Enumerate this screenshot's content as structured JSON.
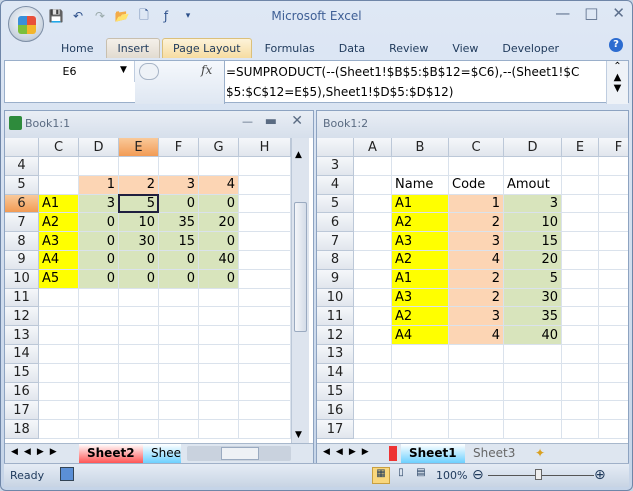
{
  "app": {
    "title": "Microsoft Excel"
  },
  "quick_access": [
    "save-icon",
    "undo-icon",
    "redo-icon",
    "open-icon",
    "new-icon",
    "insert-function-icon",
    "customize-icon"
  ],
  "ribbon_tabs": [
    "Home",
    "Insert",
    "Page Layout",
    "Formulas",
    "Data",
    "Review",
    "View",
    "Developer"
  ],
  "formula_bar": {
    "name_box": "E6",
    "fx": "fx",
    "formula": "=SUMPRODUCT(--(Sheet1!$B$5:$B$12=$C6),--(Sheet1!$C$5:$C$12=E$5),Sheet1!$D$5:$D$12)"
  },
  "colors": {
    "y": "#ffff00",
    "p": "#fcd5b4",
    "g": "#d8e4bc",
    "accent": "#f29b55"
  },
  "left_window": {
    "title": "Book1:1",
    "columns": [
      "C",
      "D",
      "E",
      "F",
      "G",
      "H"
    ],
    "selected_column": "E",
    "selected_row": "6",
    "active_cell": [
      1,
      2
    ],
    "rows": [
      {
        "n": "4",
        "cells": [
          "",
          "",
          "",
          "",
          "",
          ""
        ],
        "fills": [
          "",
          "",
          "",
          "",
          "",
          ""
        ]
      },
      {
        "n": "5",
        "cells": [
          "",
          "1",
          "2",
          "3",
          "4",
          ""
        ],
        "fills": [
          "",
          "p",
          "p",
          "p",
          "p",
          ""
        ]
      },
      {
        "n": "6",
        "cells": [
          "A1",
          "3",
          "5",
          "0",
          "0",
          ""
        ],
        "fills": [
          "y",
          "g",
          "g",
          "g",
          "g",
          ""
        ]
      },
      {
        "n": "7",
        "cells": [
          "A2",
          "0",
          "10",
          "35",
          "20",
          ""
        ],
        "fills": [
          "y",
          "g",
          "g",
          "g",
          "g",
          ""
        ]
      },
      {
        "n": "8",
        "cells": [
          "A3",
          "0",
          "30",
          "15",
          "0",
          ""
        ],
        "fills": [
          "y",
          "g",
          "g",
          "g",
          "g",
          ""
        ]
      },
      {
        "n": "9",
        "cells": [
          "A4",
          "0",
          "0",
          "0",
          "40",
          ""
        ],
        "fills": [
          "y",
          "g",
          "g",
          "g",
          "g",
          ""
        ]
      },
      {
        "n": "10",
        "cells": [
          "A5",
          "0",
          "0",
          "0",
          "0",
          ""
        ],
        "fills": [
          "y",
          "g",
          "g",
          "g",
          "g",
          ""
        ]
      },
      {
        "n": "11",
        "cells": [
          "",
          "",
          "",
          "",
          "",
          ""
        ],
        "fills": [
          "",
          "",
          "",
          "",
          "",
          ""
        ]
      },
      {
        "n": "12",
        "cells": [
          "",
          "",
          "",
          "",
          "",
          ""
        ],
        "fills": [
          "",
          "",
          "",
          "",
          "",
          ""
        ]
      },
      {
        "n": "13",
        "cells": [
          "",
          "",
          "",
          "",
          "",
          ""
        ],
        "fills": [
          "",
          "",
          "",
          "",
          "",
          ""
        ]
      },
      {
        "n": "14",
        "cells": [
          "",
          "",
          "",
          "",
          "",
          ""
        ],
        "fills": [
          "",
          "",
          "",
          "",
          "",
          ""
        ]
      },
      {
        "n": "15",
        "cells": [
          "",
          "",
          "",
          "",
          "",
          ""
        ],
        "fills": [
          "",
          "",
          "",
          "",
          "",
          ""
        ]
      },
      {
        "n": "16",
        "cells": [
          "",
          "",
          "",
          "",
          "",
          ""
        ],
        "fills": [
          "",
          "",
          "",
          "",
          "",
          ""
        ]
      },
      {
        "n": "17",
        "cells": [
          "",
          "",
          "",
          "",
          "",
          ""
        ],
        "fills": [
          "",
          "",
          "",
          "",
          "",
          ""
        ]
      },
      {
        "n": "18",
        "cells": [
          "",
          "",
          "",
          "",
          "",
          ""
        ],
        "fills": [
          "",
          "",
          "",
          "",
          "",
          ""
        ]
      }
    ],
    "sheet_tabs": [
      "Sheet2",
      "Shee"
    ]
  },
  "right_window": {
    "title": "Book1:2",
    "columns": [
      "A",
      "B",
      "C",
      "D",
      "E",
      "F"
    ],
    "rows": [
      {
        "n": "3",
        "cells": [
          "",
          "",
          "",
          "",
          "",
          ""
        ],
        "fills": [
          "",
          "",
          "",
          "",
          "",
          ""
        ]
      },
      {
        "n": "4",
        "cells": [
          "",
          "Name",
          "Code",
          "Amout",
          "",
          ""
        ],
        "fills": [
          "",
          "",
          "",
          "",
          "",
          ""
        ]
      },
      {
        "n": "5",
        "cells": [
          "",
          "A1",
          "1",
          "3",
          "",
          ""
        ],
        "fills": [
          "",
          "y",
          "p",
          "g",
          "",
          ""
        ]
      },
      {
        "n": "6",
        "cells": [
          "",
          "A2",
          "2",
          "10",
          "",
          ""
        ],
        "fills": [
          "",
          "y",
          "p",
          "g",
          "",
          ""
        ]
      },
      {
        "n": "7",
        "cells": [
          "",
          "A3",
          "3",
          "15",
          "",
          ""
        ],
        "fills": [
          "",
          "y",
          "p",
          "g",
          "",
          ""
        ]
      },
      {
        "n": "8",
        "cells": [
          "",
          "A2",
          "4",
          "20",
          "",
          ""
        ],
        "fills": [
          "",
          "y",
          "p",
          "g",
          "",
          ""
        ]
      },
      {
        "n": "9",
        "cells": [
          "",
          "A1",
          "2",
          "5",
          "",
          ""
        ],
        "fills": [
          "",
          "y",
          "p",
          "g",
          "",
          ""
        ]
      },
      {
        "n": "10",
        "cells": [
          "",
          "A3",
          "2",
          "30",
          "",
          ""
        ],
        "fills": [
          "",
          "y",
          "p",
          "g",
          "",
          ""
        ]
      },
      {
        "n": "11",
        "cells": [
          "",
          "A2",
          "3",
          "35",
          "",
          ""
        ],
        "fills": [
          "",
          "y",
          "p",
          "g",
          "",
          ""
        ]
      },
      {
        "n": "12",
        "cells": [
          "",
          "A4",
          "4",
          "40",
          "",
          ""
        ],
        "fills": [
          "",
          "y",
          "p",
          "g",
          "",
          ""
        ]
      },
      {
        "n": "13",
        "cells": [
          "",
          "",
          "",
          "",
          "",
          ""
        ],
        "fills": [
          "",
          "",
          "",
          "",
          "",
          ""
        ]
      },
      {
        "n": "14",
        "cells": [
          "",
          "",
          "",
          "",
          "",
          ""
        ],
        "fills": [
          "",
          "",
          "",
          "",
          "",
          ""
        ]
      },
      {
        "n": "15",
        "cells": [
          "",
          "",
          "",
          "",
          "",
          ""
        ],
        "fills": [
          "",
          "",
          "",
          "",
          "",
          ""
        ]
      },
      {
        "n": "16",
        "cells": [
          "",
          "",
          "",
          "",
          "",
          ""
        ],
        "fills": [
          "",
          "",
          "",
          "",
          "",
          ""
        ]
      },
      {
        "n": "17",
        "cells": [
          "",
          "",
          "",
          "",
          "",
          ""
        ],
        "fills": [
          "",
          "",
          "",
          "",
          "",
          ""
        ]
      }
    ],
    "sheet_tabs": [
      "Sheet1",
      "Sheet3"
    ]
  },
  "status": {
    "text": "Ready",
    "zoom": "100%",
    "zoom_percent": 100
  }
}
